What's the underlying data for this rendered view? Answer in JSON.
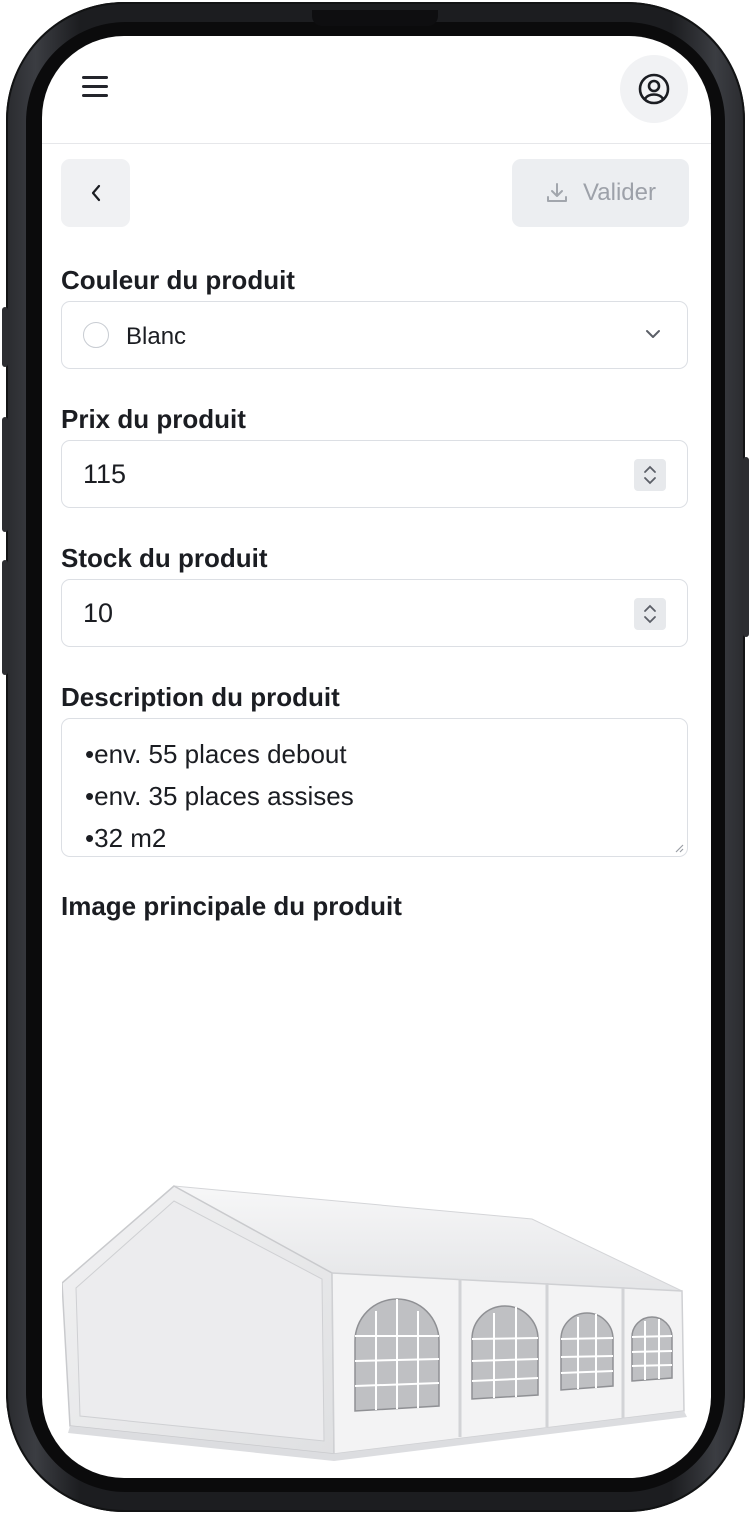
{
  "header": {
    "menu_icon": "hamburger-icon",
    "profile_icon": "user-circle-icon"
  },
  "toolbar": {
    "back_icon": "chevron-left-icon",
    "validate_label": "Valider",
    "validate_icon": "download-icon"
  },
  "form": {
    "color": {
      "label": "Couleur du produit",
      "value": "Blanc",
      "swatch": "#ffffff"
    },
    "price": {
      "label": "Prix du produit",
      "value": "115"
    },
    "stock": {
      "label": "Stock du produit",
      "value": "10"
    },
    "description": {
      "label": "Description du produit",
      "lines": [
        "•env. 55 places debout",
        "•env. 35 places assises",
        "•32 m2"
      ]
    },
    "image": {
      "label": "Image principale du produit"
    }
  },
  "colors": {
    "button_bg": "#f0f1f3",
    "disabled_text": "#9da1a9",
    "border": "#dcdfe4",
    "text": "#1b1d22"
  }
}
